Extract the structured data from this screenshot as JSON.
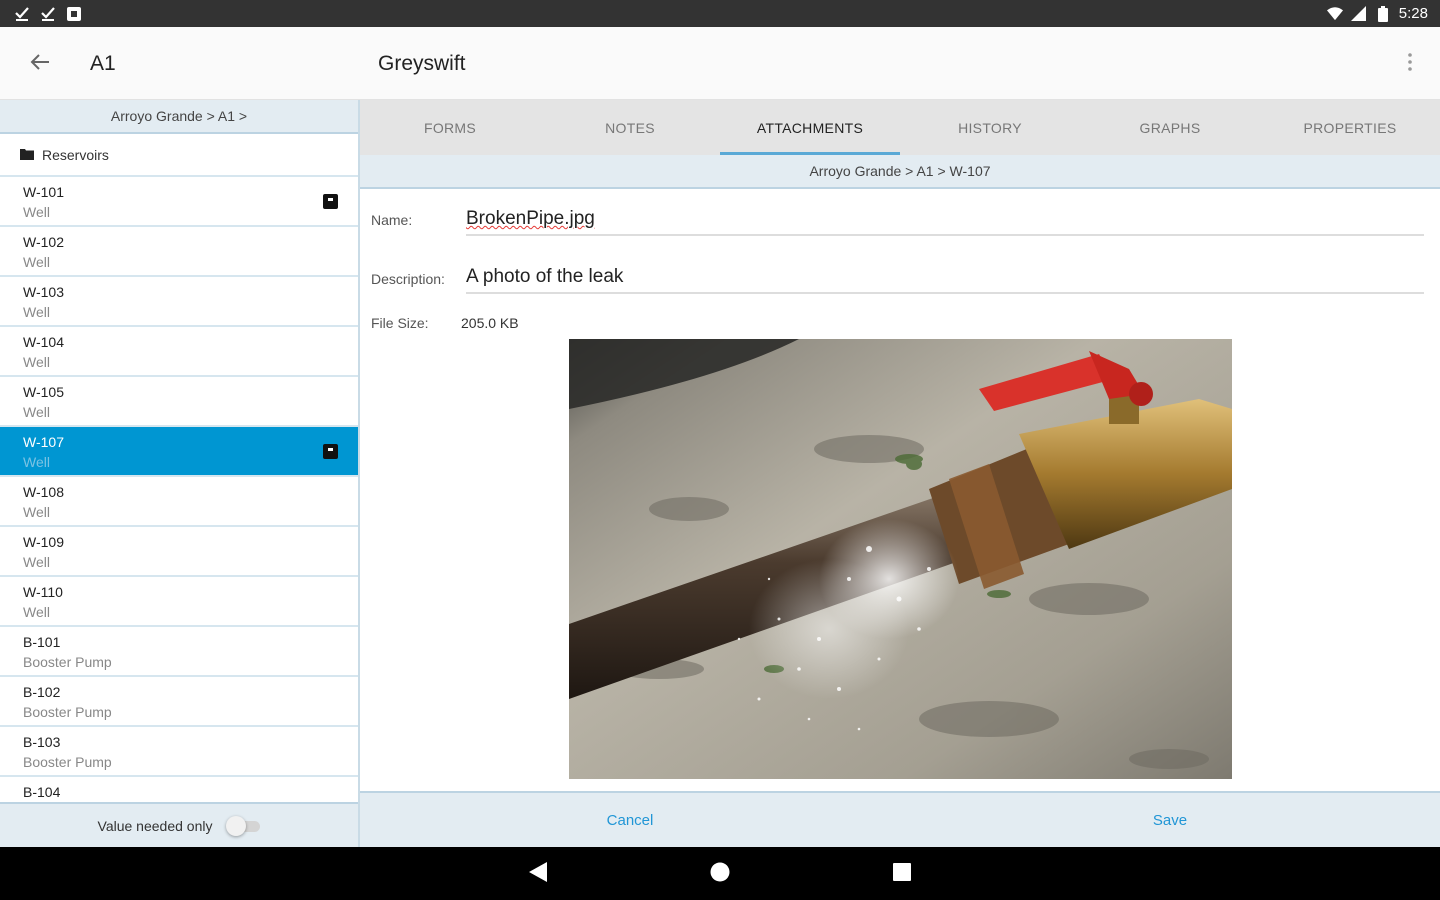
{
  "status_bar": {
    "time": "5:28",
    "left_icons": [
      "download-done-icon",
      "download-done-icon",
      "app-notification-icon"
    ],
    "right_icons": [
      "wifi-icon",
      "signal-icon",
      "battery-icon"
    ]
  },
  "app_bar": {
    "title": "A1",
    "subtitle": "Greyswift",
    "back_icon": "arrow-back-icon",
    "overflow_icon": "more-vert-icon"
  },
  "left_panel": {
    "breadcrumb": "Arroyo Grande > A1 >",
    "folder": {
      "label": "Reservoirs",
      "icon": "folder-icon"
    },
    "items": [
      {
        "name": "W-101",
        "type": "Well",
        "has_attachment": true,
        "selected": false
      },
      {
        "name": "W-102",
        "type": "Well",
        "has_attachment": false,
        "selected": false
      },
      {
        "name": "W-103",
        "type": "Well",
        "has_attachment": false,
        "selected": false
      },
      {
        "name": "W-104",
        "type": "Well",
        "has_attachment": false,
        "selected": false
      },
      {
        "name": "W-105",
        "type": "Well",
        "has_attachment": false,
        "selected": false
      },
      {
        "name": "W-107",
        "type": "Well",
        "has_attachment": true,
        "selected": true
      },
      {
        "name": "W-108",
        "type": "Well",
        "has_attachment": false,
        "selected": false
      },
      {
        "name": "W-109",
        "type": "Well",
        "has_attachment": false,
        "selected": false
      },
      {
        "name": "W-110",
        "type": "Well",
        "has_attachment": false,
        "selected": false
      },
      {
        "name": "B-101",
        "type": "Booster Pump",
        "has_attachment": false,
        "selected": false
      },
      {
        "name": "B-102",
        "type": "Booster Pump",
        "has_attachment": false,
        "selected": false
      },
      {
        "name": "B-103",
        "type": "Booster Pump",
        "has_attachment": false,
        "selected": false
      },
      {
        "name": "B-104",
        "type": "",
        "has_attachment": false,
        "selected": false
      }
    ],
    "footer": {
      "label": "Value needed only",
      "toggle_on": false
    }
  },
  "tabs": [
    {
      "label": "FORMS",
      "active": false
    },
    {
      "label": "NOTES",
      "active": false
    },
    {
      "label": "ATTACHMENTS",
      "active": true
    },
    {
      "label": "HISTORY",
      "active": false
    },
    {
      "label": "GRAPHS",
      "active": false
    },
    {
      "label": "PROPERTIES",
      "active": false
    }
  ],
  "attachment": {
    "breadcrumb": "Arroyo Grande > A1 > W-107",
    "name_label": "Name:",
    "name_value": "BrokenPipe.jpg",
    "description_label": "Description:",
    "description_value": "A photo of the leak",
    "filesize_label": "File Size:",
    "filesize_value": "205.0 KB"
  },
  "actions": {
    "cancel": "Cancel",
    "save": "Save"
  },
  "nav_bar": {
    "icons": [
      "nav-back-icon",
      "nav-home-icon",
      "nav-recents-icon"
    ]
  },
  "colors": {
    "accent": "#0096d2",
    "link": "#2196d6",
    "panel_header": "#e3ecf2",
    "tab_bar": "#e4e4e4",
    "tab_indicator": "#5aa9d6",
    "status_bar": "#333333",
    "valve_handle": "#d9322b"
  }
}
